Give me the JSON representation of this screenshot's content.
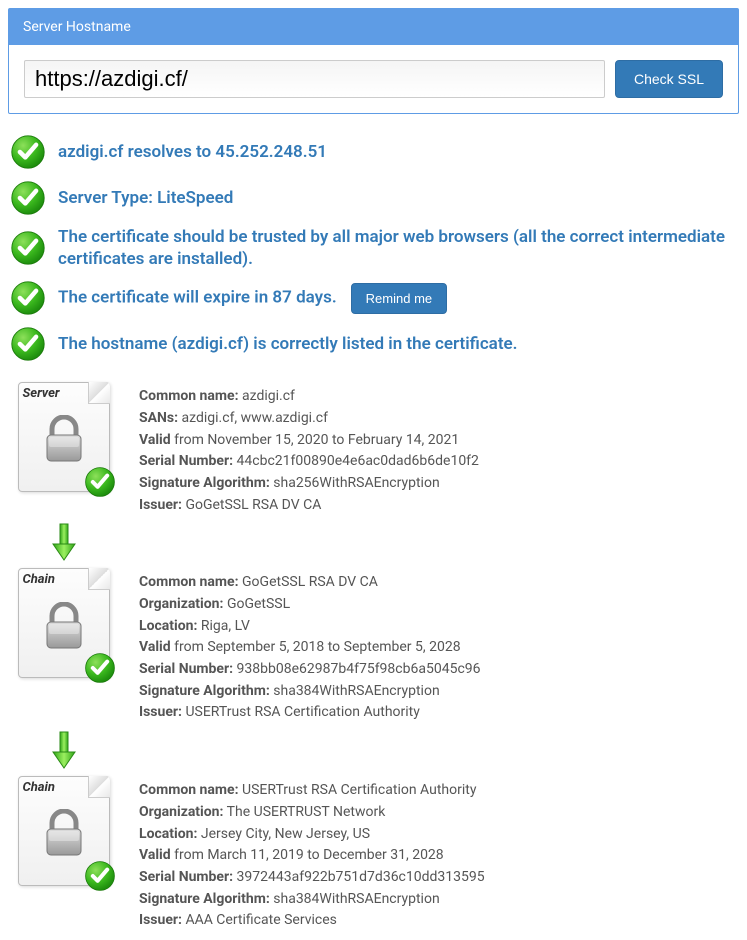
{
  "panel": {
    "title": "Server Hostname",
    "url": "https://azdigi.cf/",
    "check_label": "Check SSL"
  },
  "status": {
    "resolves": "azdigi.cf resolves to 45.252.248.51",
    "server_type": "Server Type: LiteSpeed",
    "trusted": "The certificate should be trusted by all major web browsers (all the correct intermediate certificates are installed).",
    "expire": "The certificate will expire in 87 days.",
    "remind_label": "Remind me",
    "hostname_listed": "The hostname (azdigi.cf) is correctly listed in the certificate."
  },
  "certs": [
    {
      "label": "Server",
      "cn_label": "Common name:",
      "cn": "azdigi.cf",
      "sans_label": "SANs:",
      "sans": "azdigi.cf, www.azdigi.cf",
      "org_label": "",
      "org": "",
      "loc_label": "",
      "loc": "",
      "valid_label": "Valid",
      "valid": "from November 15, 2020 to February 14, 2021",
      "serial_label": "Serial Number:",
      "serial": "44cbc21f00890e4e6ac0dad6b6de10f2",
      "sig_label": "Signature Algorithm:",
      "sig": "sha256WithRSAEncryption",
      "issuer_label": "Issuer:",
      "issuer": "GoGetSSL RSA DV CA"
    },
    {
      "label": "Chain",
      "cn_label": "Common name:",
      "cn": "GoGetSSL RSA DV CA",
      "sans_label": "",
      "sans": "",
      "org_label": "Organization:",
      "org": "GoGetSSL",
      "loc_label": "Location:",
      "loc": "Riga, LV",
      "valid_label": "Valid",
      "valid": "from September 5, 2018 to September 5, 2028",
      "serial_label": "Serial Number:",
      "serial": "938bb08e62987b4f75f98cb6a5045c96",
      "sig_label": "Signature Algorithm:",
      "sig": "sha384WithRSAEncryption",
      "issuer_label": "Issuer:",
      "issuer": "USERTrust RSA Certification Authority"
    },
    {
      "label": "Chain",
      "cn_label": "Common name:",
      "cn": "USERTrust RSA Certification Authority",
      "sans_label": "",
      "sans": "",
      "org_label": "Organization:",
      "org": "The USERTRUST Network",
      "loc_label": "Location:",
      "loc": "Jersey City, New Jersey, US",
      "valid_label": "Valid",
      "valid": "from March 11, 2019 to December 31, 2028",
      "serial_label": "Serial Number:",
      "serial": "3972443af922b751d7d36c10dd313595",
      "sig_label": "Signature Algorithm:",
      "sig": "sha384WithRSAEncryption",
      "issuer_label": "Issuer:",
      "issuer": "AAA Certificate Services"
    }
  ]
}
